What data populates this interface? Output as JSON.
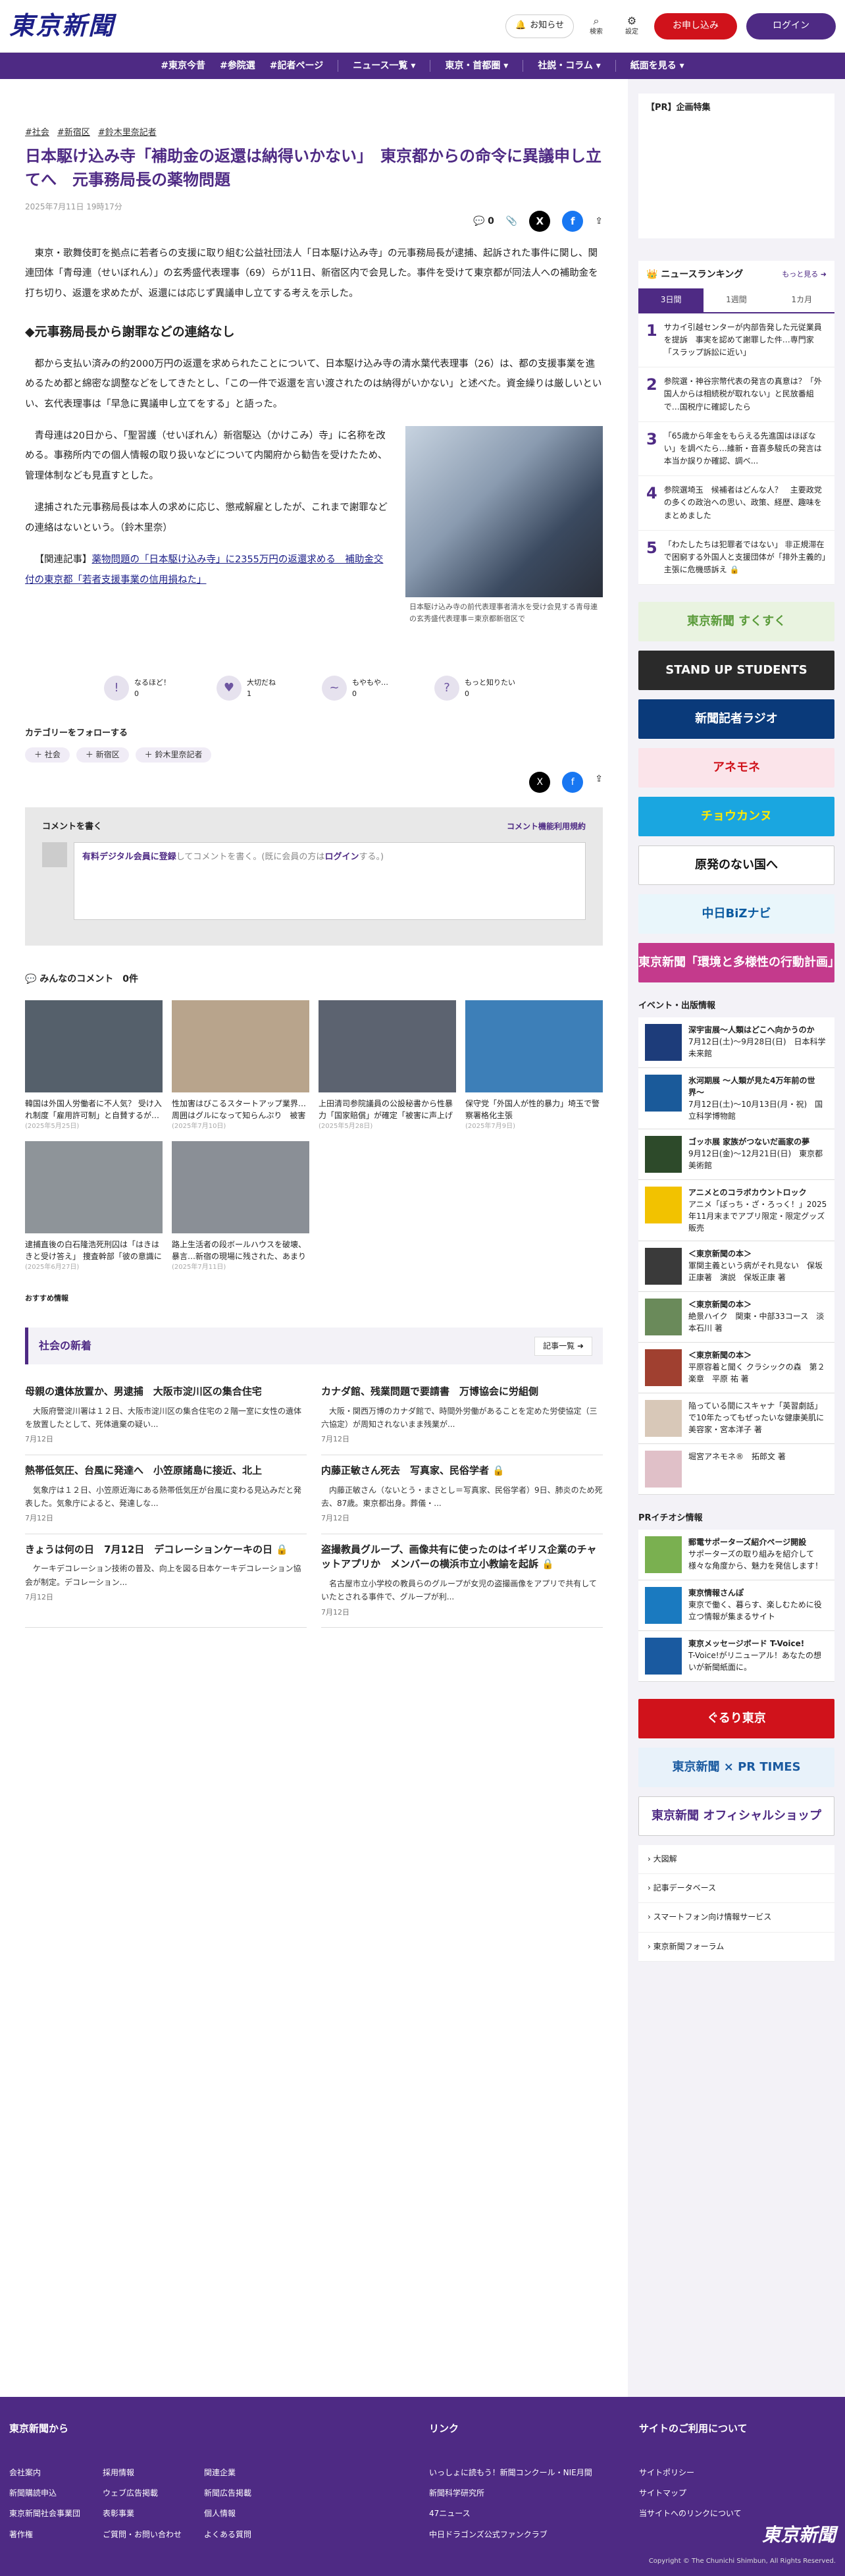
{
  "header": {
    "logo": "東京新聞",
    "notice": "お知らせ",
    "search": "検索",
    "settings": "設定",
    "subscribe": "お申し込み",
    "login": "ログイン"
  },
  "nav": [
    "#東京今昔",
    "#参院選",
    "#記者ページ",
    "ニュース一覧 ▾",
    "東京・首都圏 ▾",
    "社説・コラム ▾",
    "紙面を見る ▾"
  ],
  "article": {
    "tags": [
      "#社会",
      "#新宿区",
      "#鈴木里奈記者"
    ],
    "title": "日本駆け込み寺「補助金の返還は納得いかない」　東京都からの命令に異議申し立てへ　元事務局長の薬物問題",
    "date": "2025年7月11日 19時17分",
    "comment_count": "0",
    "p1": "東京・歌舞伎町を拠点に若者らの支援に取り組む公益社団法人「日本駆け込み寺」の元事務局長が逮捕、起訴された事件に関し、関連団体「青母連（せいぼれん）」の玄秀盛代表理事（69）らが11日、新宿区内で会見した。事件を受けて東京都が同法人への補助金を打ち切り、返還を求めたが、返還には応じず異議申し立てする考えを示した。",
    "h2": "◆元事務局長から謝罪などの連絡なし",
    "p2": "都から支払い済みの約2000万円の返還を求められたことについて、日本駆け込み寺の清水葉代表理事（26）は、都の支援事業を進めるため都と綿密な調整などをしてきたとし、「この一件で返還を言い渡されたのは納得がいかない」と述べた。資金繰りは厳しいといい、玄代表理事は「早急に異議申し立てをする」と語った。",
    "p3": "青母連は20日から、「聖習護（せいぼれん）新宿駆込（かけこみ）寺」に名称を改める。事務所内での個人情報の取り扱いなどについて内閣府から勧告を受けたため、管理体制なども見直すとした。",
    "p4": "逮捕された元事務局長は本人の求めに応じ、懲戒解雇としたが、これまで謝罪などの連絡はないという。（鈴木里奈）",
    "related_prefix": "【関連記事】",
    "related_link": "薬物問題の「日本駆け込み寺」に2355万円の返還求める　補助金交付の東京都「若者支援事業の信用損ねた」",
    "caption": "日本駆け込み寺の前代表理事者清水を受け会見する青母連の玄秀盛代表理事＝東京都新宿区で"
  },
  "reactions": [
    {
      "label": "なるほど！",
      "count": "0",
      "icon": "!"
    },
    {
      "label": "大切だね",
      "count": "1",
      "icon": "♥"
    },
    {
      "label": "もやもや…",
      "count": "0",
      "icon": "~"
    },
    {
      "label": "もっと知りたい",
      "count": "0",
      "icon": "?"
    }
  ],
  "follow": {
    "title": "カテゴリーをフォローする",
    "chips": [
      "＋ 社会",
      "＋ 新宿区",
      "＋ 鈴木里奈記者"
    ]
  },
  "comments": {
    "title": "コメントを書く",
    "rules": "コメント機能利用規約",
    "placeholder_bold": "有料デジタル会員に登録",
    "placeholder_rest": "してコメントを書く。(既に会員の方は",
    "login_word": "ログイン",
    "tail": "する。)",
    "everyone": "みんなのコメント　0件"
  },
  "cards": [
    {
      "t": "韓国は外国人労働者に不人気？ 受け入れ制度「雇用許可制」と自賛するが…16万5000人の枠が半...",
      "d": "(2025年5月25日)",
      "c": "#55606b"
    },
    {
      "t": "性加害はびこるスタートアップ業界…周囲はグルになって知らんぷり　被害にあい、改善へ...",
      "d": "(2025年7月10日)",
      "c": "#b8a48c"
    },
    {
      "t": "上田清司参院議員の公設秘書から性暴力「国家賠償」が確定「被害に声上げることがため...",
      "d": "(2025年5月28日)",
      "c": "#5c6370"
    },
    {
      "t": "保守党「外国人が性的暴力」埼玉で警察署格化主張",
      "d": "(2025年7月9日)",
      "c": "#3d7fb8"
    },
    {
      "t": "逮捕直後の白石隆浩死刑囚は「はきはきと受け答え」 捜査幹部「彼の意識に未練が…よ...",
      "d": "(2025年6月27日)",
      "c": "#8e9499"
    },
    {
      "t": "路上生活者の段ボールハウスを破壊、暴言…新宿の現場に残された、あまりの非道と「やり...",
      "d": "(2025年7月11日)",
      "c": "#8a8f96"
    }
  ],
  "recommended": "おすすめ情報",
  "society": {
    "title": "社会の新着",
    "more": "記事一覧 ➜",
    "items": [
      {
        "t": "母親の遺体放置か、男逮捕　大阪市淀川区の集合住宅",
        "s": "大阪府警淀川署は１２日、大阪市淀川区の集合住宅の２階一室に女性の遺体を放置したとして、死体遺棄の疑い...",
        "d": "7月12日",
        "lock": ""
      },
      {
        "t": "カナダ館、残業問題で要請書　万博協会に労組側",
        "s": "大阪・関西万博のカナダ館で、時間外労働があることを定めた労使協定（三六協定）が周知されないまま残業が...",
        "d": "7月12日",
        "lock": ""
      },
      {
        "t": "熱帯低気圧、台風に発達へ　小笠原諸島に接近、北上",
        "s": "気象庁は１２日、小笠原近海にある熱帯低気圧が台風に変わる見込みだと発表した。気象庁によると、発達しな...",
        "d": "7月12日",
        "lock": ""
      },
      {
        "t": "内藤正敏さん死去　写真家、民俗学者",
        "s": "内藤正敏さん（ないとう・まさとし＝写真家、民俗学者）9日、肺炎のため死去、87歳。東京都出身。葬儀・...",
        "d": "7月12日",
        "lock": "🔒"
      },
      {
        "t": "きょうは何の日　7月12日　デコレーションケーキの日",
        "s": "ケーキデコレーション技術の普及、向上を図る日本ケーキデコレーション協会が制定。デコレーション...",
        "d": "7月12日",
        "lock": "🔒"
      },
      {
        "t": "盗撮教員グループ、画像共有に使ったのはイギリス企業のチャットアプリか　メンバーの横浜市立小教諭を起訴",
        "s": "名古屋市立小学校の教員らのグループが女児の盗撮画像をアプリで共有していたとされる事件で、グループが利...",
        "d": "7月12日",
        "lock": "🔒"
      }
    ]
  },
  "side": {
    "pr": "【PR】企画特集",
    "ranking": {
      "title": "ニュースランキング",
      "more": "もっと見る ➜",
      "tabs": [
        "3日間",
        "1週間",
        "1カ月"
      ],
      "items": [
        "サカイ引越センターが内部告発した元従業員を提訴　事実を認めて謝罪した件…専門家「スラップ訴訟に近い」",
        "参院選・神谷宗幣代表の発言の真意は？「外国人からは相続税が取れない」と民放番組で…国税庁に確認したら",
        "「65歳から年金をもらえる先進国はほぼない」を調べたら…維新・音喜多駿氏の発言は本当か誤りか確認、調べ...",
        "参院選埼玉　候補者はどんな人？　主要政党の多くの政治への思い、政策、経歴、趣味をまとめました",
        "「わたしたちは犯罪者ではない」 非正規滞在で困窮する外国人と支援団体が「排外主義的」主張に危機感訴え 🔒"
      ]
    },
    "banners": [
      {
        "t": "東京新聞 すくすく",
        "bg": "#e9f3e0",
        "fg": "#5a9b3a"
      },
      {
        "t": "STAND UP STUDENTS",
        "bg": "#2a2a2a",
        "fg": "#fff"
      },
      {
        "t": "新聞記者ラジオ",
        "bg": "#0a3a7a",
        "fg": "#fff"
      },
      {
        "t": "アネモネ",
        "bg": "#fbe4ea",
        "fg": "#d0121b"
      },
      {
        "t": "チョウカンヌ",
        "bg": "#1aa6e0",
        "fg": "#ffea00"
      },
      {
        "t": "原発のない国へ",
        "bg": "#fff",
        "fg": "#111"
      },
      {
        "t": "中日BiZナビ",
        "bg": "#e9f6fb",
        "fg": "#0a5aa0"
      },
      {
        "t": "東京新聞「環境と多様性の行動計画」",
        "bg": "#c43a8c",
        "fg": "#fff"
      }
    ],
    "events_title": "イベント・出版情報",
    "events": [
      {
        "b": "深宇宙展〜人類はどこへ向かうのか",
        "s": "7月12日(土)〜9月28日(日)　日本科学未来館",
        "c": "#1d3c7a"
      },
      {
        "b": "氷河期展 〜人類が見た4万年前の世界〜",
        "s": "7月12日(土)〜10月13日(月・祝)　国立科学博物館",
        "c": "#1a5a9a"
      },
      {
        "b": "ゴッホ展 家族がつないだ画家の夢",
        "s": "9月12日(金)〜12月21日(日)　東京都美術館",
        "c": "#2d4a2a"
      },
      {
        "b": "アニメとのコラボカウントロック",
        "s": "アニメ「ぼっち・ざ・ろっく！」2025年11月末までアプリ限定・限定グッズ販売",
        "c": "#f2c200"
      },
      {
        "b": "＜東京新聞の本＞",
        "s": "軍関主義という病がそれ見ない　保坂正康著　演説　保坂正康 著",
        "c": "#3a3a3a"
      },
      {
        "b": "＜東京新聞の本＞",
        "s": "絶景ハイク　関東・中部33コース　淡本石川 著",
        "c": "#6a8a5a"
      },
      {
        "b": "＜東京新聞の本＞",
        "s": "平原容着と聞く クラシックの森　第２楽章　平原 祐 著",
        "c": "#a04030"
      },
      {
        "b": "",
        "s": "陥っている間にスキャナ「英習劇話」で10年たってもぜったいな健康美肌に　美容家・宮本洋子 著",
        "c": "#d8c8b8"
      },
      {
        "b": "",
        "s": "堀宮アネモネ®　拓郎文 著",
        "c": "#e0c0c8"
      }
    ],
    "pr_info": "PRイチオシ情報",
    "pr_items": [
      {
        "b": "郵電サポーターズ紹介ページ開設",
        "s": "サポーターズの取り組みを紹介して様々な角度から、魅力を発信します！",
        "c": "#7ab050"
      },
      {
        "b": "東京情報さんぽ",
        "s": "東京で働く、暮らす、楽しむために役立つ情報が集まるサイト",
        "c": "#1a7ac0"
      },
      {
        "b": "東京メッセージボード T-Voice!",
        "s": "T-Voice!がリニューアル！あなたの想いが新聞紙面に。",
        "c": "#1a5aa0"
      }
    ],
    "bottom_banners": [
      {
        "t": "ぐるり東京",
        "bg": "#d0121b",
        "fg": "#fff"
      },
      {
        "t": "東京新聞 × PR TIMES",
        "bg": "#e8f2fa",
        "fg": "#1a5aa0"
      },
      {
        "t": "東京新聞 オフィシャルショップ",
        "bg": "#fff",
        "fg": "#4e2a84"
      }
    ],
    "links": [
      "大図解",
      "記事データベース",
      "スマートフォン向け情報サービス",
      "東京新聞フォーラム"
    ]
  },
  "footer": {
    "from": "東京新聞から",
    "col1": [
      "会社案内",
      "新聞購読申込",
      "東京新聞社会事業団",
      "著作権"
    ],
    "col2": [
      "採用情報",
      "ウェブ広告掲載",
      "表彰事業",
      "ご質問・お問い合わせ"
    ],
    "col3": [
      "関連企業",
      "新聞広告掲載",
      "個人情報",
      "よくある質問"
    ],
    "links_title": "リンク",
    "links": [
      "いっしょに読もう！新聞コンクール・NIE月間",
      "新聞科学研究所",
      "47ニュース",
      "中日ドラゴンズ公式ファンクラブ"
    ],
    "site_title": "サイトのご利用について",
    "site": [
      "サイトポリシー",
      "サイトマップ",
      "当サイトへのリンクについて"
    ],
    "logo": "東京新聞",
    "copyright": "Copyright © The Chunichi Shimbun, All Rights Reserved."
  }
}
